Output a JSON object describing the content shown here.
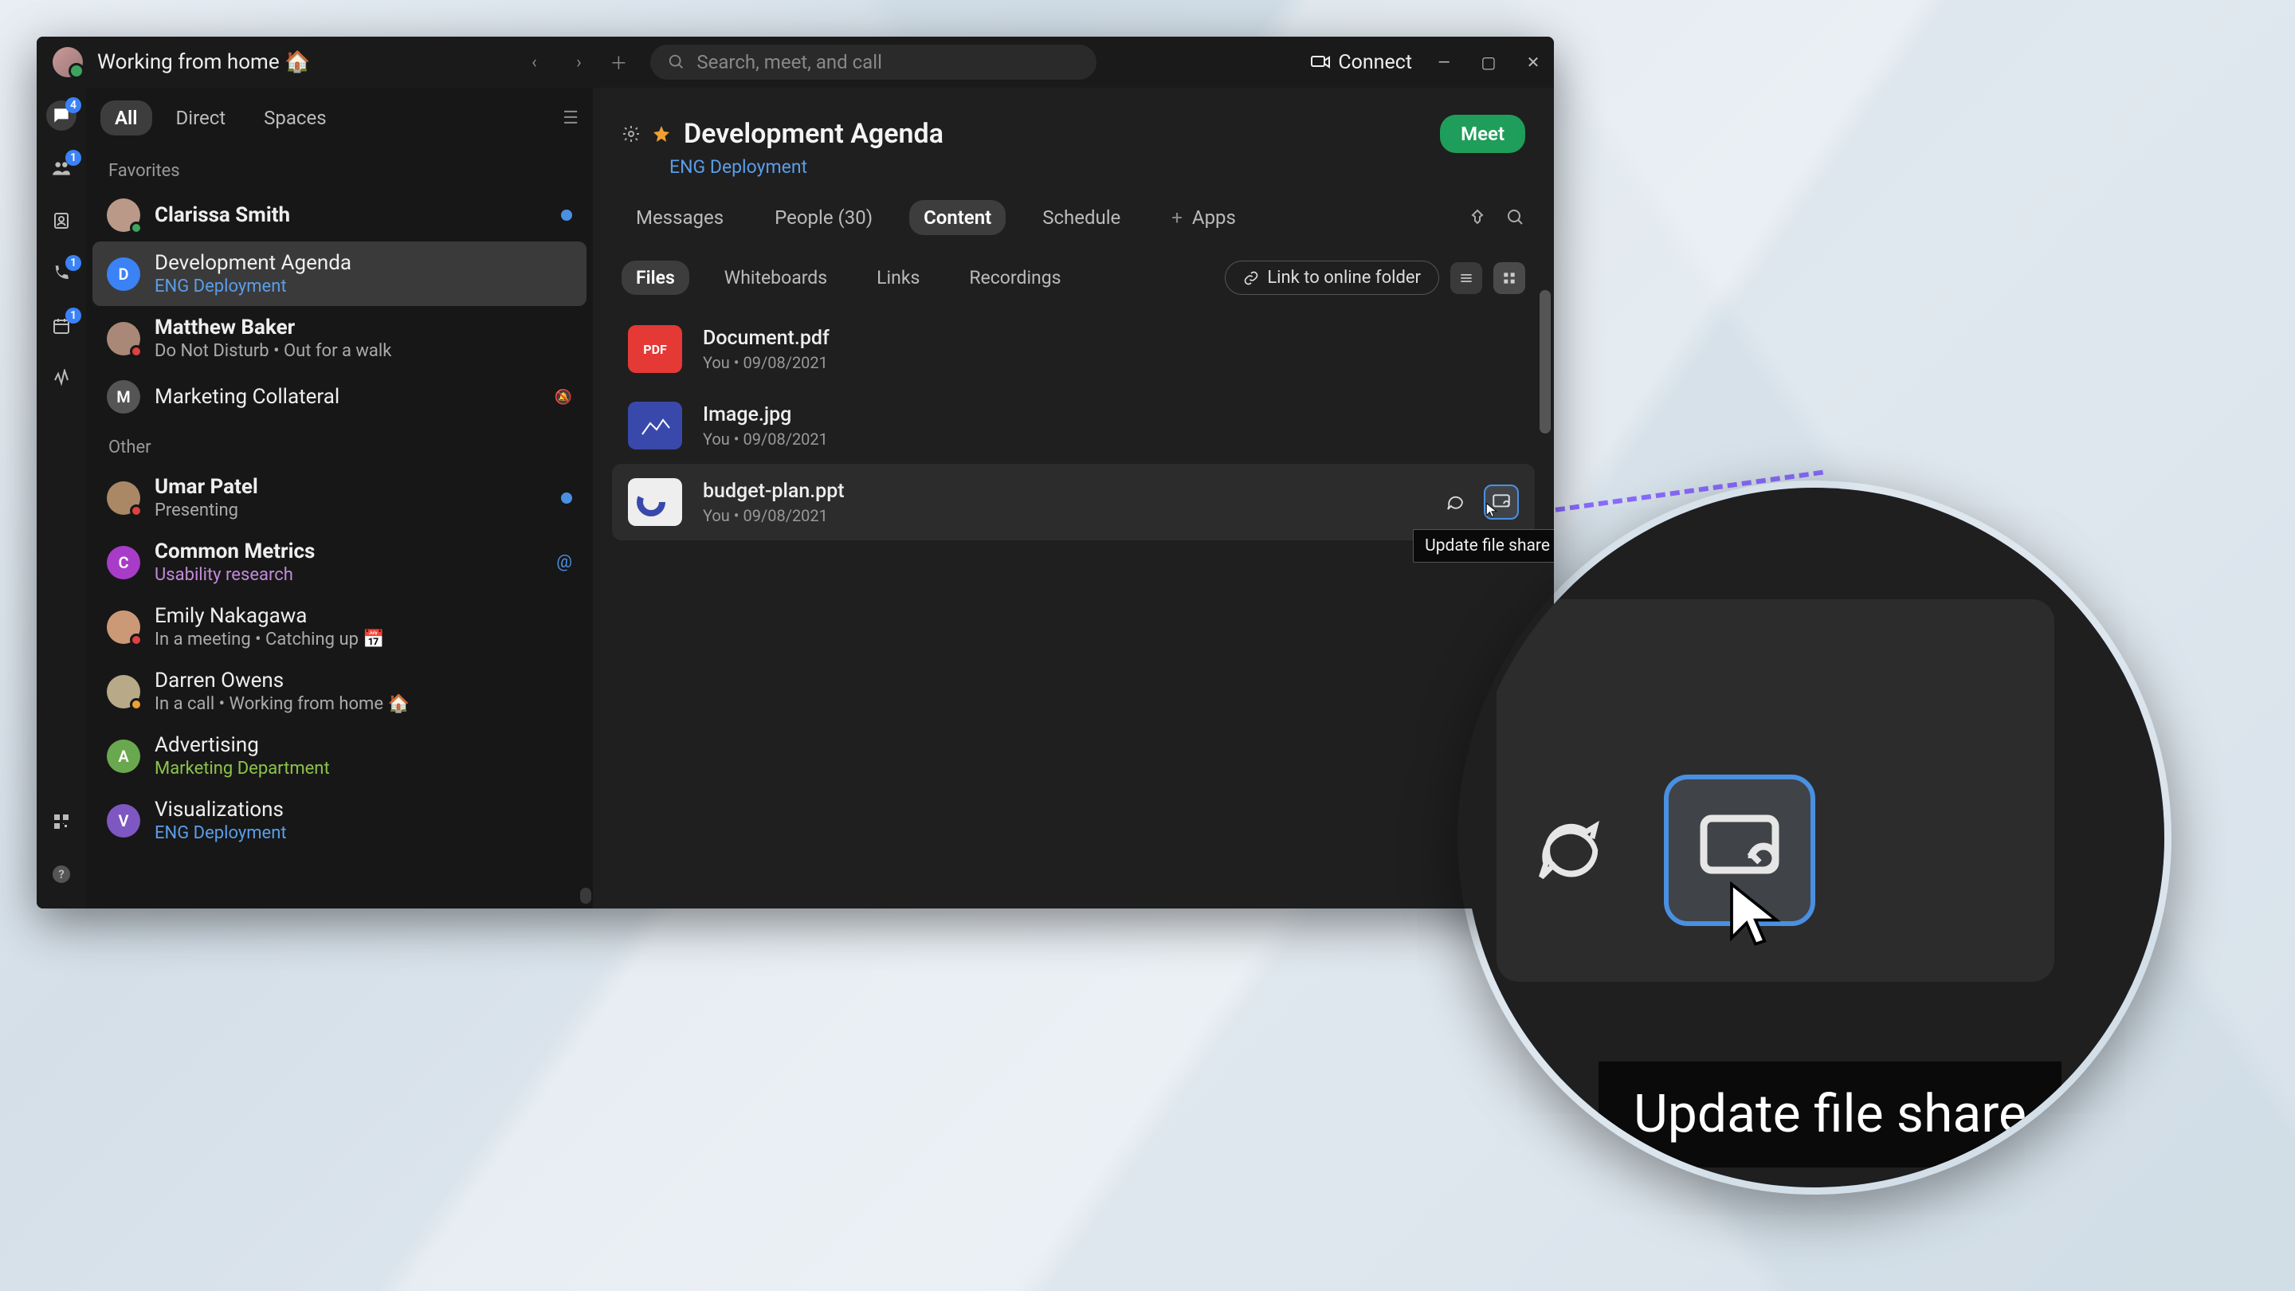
{
  "titlebar": {
    "status_text": "Working from home 🏠",
    "search_placeholder": "Search, meet, and call",
    "connect_label": "Connect"
  },
  "rail": {
    "messaging_badge": "4",
    "teams_badge": "1",
    "calls_badge": "1",
    "calendar_badge": "1"
  },
  "sidebar": {
    "tabs": {
      "all": "All",
      "direct": "Direct",
      "spaces": "Spaces"
    },
    "section_favorites": "Favorites",
    "section_other": "Other",
    "favorites": [
      {
        "name": "Clarissa Smith",
        "sub": "",
        "avatar_bg": "#b98",
        "presence": "#3ba55d",
        "bold": true,
        "dot": true
      },
      {
        "name": "Development Agenda",
        "sub": "ENG Deployment",
        "avatar_letter": "D",
        "avatar_bg": "#3b82f6",
        "sub_class": "accent",
        "selected": true
      },
      {
        "name": "Matthew Baker",
        "sub": "Do Not Disturb  •  Out for a walk",
        "avatar_bg": "#aa8877",
        "presence": "#e04040",
        "bold": true
      },
      {
        "name": "Marketing Collateral",
        "sub": "",
        "avatar_letter": "M",
        "avatar_bg": "#555",
        "muted": true
      }
    ],
    "other": [
      {
        "name": "Umar Patel",
        "sub": "Presenting",
        "avatar_bg": "#aa8866",
        "presence": "#e04040",
        "bold": true,
        "dot": true
      },
      {
        "name": "Common Metrics",
        "sub": "Usability research",
        "avatar_letter": "C",
        "avatar_bg": "#a83cc9",
        "sub_class": "purple",
        "bold": true,
        "mention": true
      },
      {
        "name": "Emily Nakagawa",
        "sub": "In a meeting  •  Catching up 📅",
        "avatar_bg": "#cc9977",
        "presence": "#e04040"
      },
      {
        "name": "Darren Owens",
        "sub": "In a call  •  Working from home 🏠",
        "avatar_bg": "#b8aa88",
        "presence": "#f0a030"
      },
      {
        "name": "Advertising",
        "sub": "Marketing Department",
        "avatar_letter": "A",
        "avatar_bg": "#6aa84f",
        "sub_class": "green"
      },
      {
        "name": "Visualizations",
        "sub": "ENG Deployment",
        "avatar_letter": "V",
        "avatar_bg": "#7e57c2",
        "sub_class": "accent"
      }
    ]
  },
  "main": {
    "title": "Development Agenda",
    "subtitle": "ENG Deployment",
    "meet_label": "Meet",
    "tabs": {
      "messages": "Messages",
      "people": "People (30)",
      "content": "Content",
      "schedule": "Schedule",
      "apps": "Apps",
      "apps_prefix": "+"
    },
    "subtabs": {
      "files": "Files",
      "whiteboards": "Whiteboards",
      "links": "Links",
      "recordings": "Recordings",
      "link_folder": "Link to online folder"
    },
    "files": [
      {
        "name": "Document.pdf",
        "owner": "You",
        "date": "09/08/2021",
        "thumb_bg": "#e53935",
        "thumb_label": "PDF"
      },
      {
        "name": "Image.jpg",
        "owner": "You",
        "date": "09/08/2021",
        "thumb_bg": "#3949ab",
        "thumb_label": ""
      },
      {
        "name": "budget-plan.ppt",
        "owner": "You",
        "date": "09/08/2021",
        "thumb_bg": "#eeeeee",
        "thumb_label": "",
        "hover": true
      }
    ],
    "tooltip": "Update file share"
  },
  "zoom": {
    "tooltip": "Update file share"
  }
}
